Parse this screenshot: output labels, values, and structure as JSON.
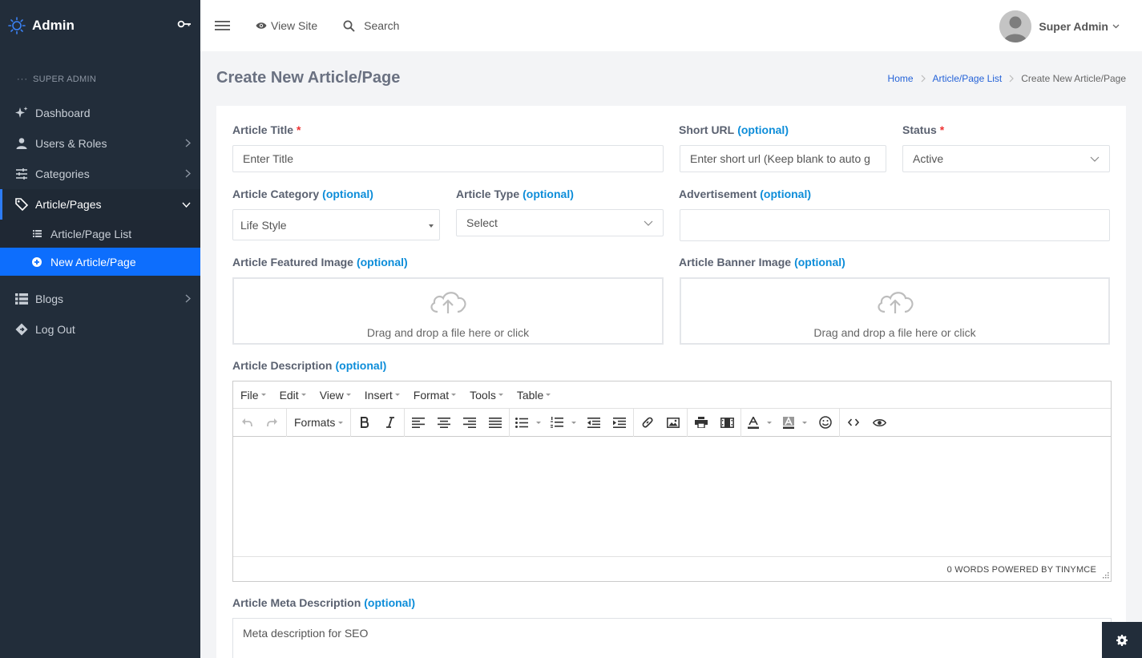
{
  "brand": {
    "title": "Admin"
  },
  "sidebar": {
    "section": "SUPER ADMIN",
    "items": [
      {
        "label": "Dashboard",
        "icon": "sparkle-icon"
      },
      {
        "label": "Users & Roles",
        "icon": "user-icon"
      },
      {
        "label": "Categories",
        "icon": "sliders-icon"
      },
      {
        "label": "Article/Pages",
        "icon": "tags-icon"
      },
      {
        "label": "Blogs",
        "icon": "list-icon"
      },
      {
        "label": "Log Out",
        "icon": "diamond-icon"
      }
    ],
    "subitems": [
      {
        "label": "Article/Page List"
      },
      {
        "label": "New Article/Page"
      }
    ]
  },
  "topbar": {
    "view_site": "View Site",
    "search": "Search",
    "user_name": "Super Admin"
  },
  "page": {
    "title": "Create New Article/Page",
    "breadcrumb": [
      "Home",
      "Article/Page List",
      "Create New Article/Page"
    ]
  },
  "form": {
    "article_title": {
      "label": "Article Title",
      "required": "*",
      "placeholder": "Enter Title"
    },
    "short_url": {
      "label": "Short URL",
      "optional": "(optional)",
      "placeholder": "Enter short url (Keep blank to auto g"
    },
    "status": {
      "label": "Status",
      "required": "*",
      "value": "Active"
    },
    "category": {
      "label": "Article Category",
      "optional": "(optional)",
      "value": "Life Style"
    },
    "type": {
      "label": "Article Type",
      "optional": "(optional)",
      "value": "Select"
    },
    "advertisement": {
      "label": "Advertisement",
      "optional": "(optional)",
      "value": ""
    },
    "featured_image": {
      "label": "Article Featured Image",
      "optional": "(optional)",
      "hint": "Drag and drop a file here or click"
    },
    "banner_image": {
      "label": "Article Banner Image",
      "optional": "(optional)",
      "hint": "Drag and drop a file here or click"
    },
    "description": {
      "label": "Article Description",
      "optional": "(optional)"
    },
    "meta": {
      "label": "Article Meta Description",
      "optional": "(optional)",
      "placeholder": "Meta description for SEO"
    }
  },
  "editor": {
    "menus": [
      "File",
      "Edit",
      "View",
      "Insert",
      "Format",
      "Tools",
      "Table"
    ],
    "formats": "Formats",
    "status": "0 WORDS POWERED BY TINYMCE"
  },
  "colors": {
    "sidebar": "#222d3a",
    "accent": "#0d6efd",
    "optional": "#0d8dd9",
    "required": "#e33333"
  }
}
